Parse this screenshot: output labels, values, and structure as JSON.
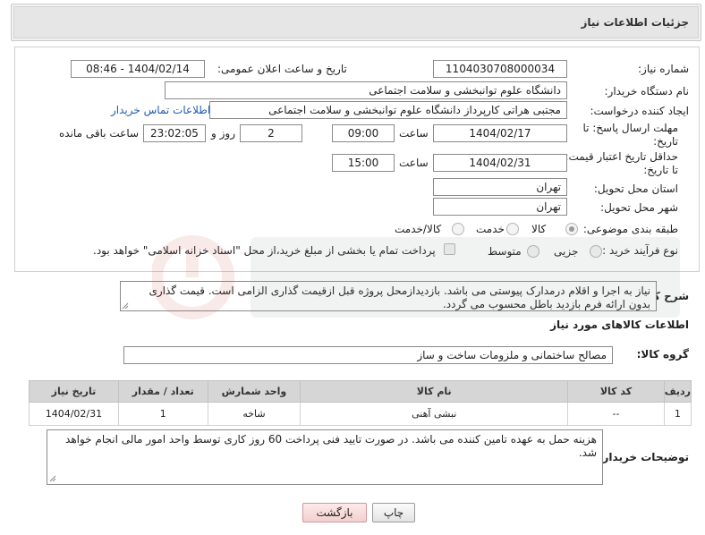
{
  "panel": {
    "title": "جزئیات اطلاعات نیاز"
  },
  "form": {
    "need_number": {
      "label": "شماره نیاز:",
      "value": "1104030708000034"
    },
    "announce_datetime": {
      "label": "تاریخ و ساعت اعلان عمومی:",
      "value": "1404/02/14 - 08:46"
    },
    "buyer_org": {
      "label": "نام دستگاه خریدار:",
      "value": "دانشگاه علوم توانبخشی و سلامت اجتماعی"
    },
    "requester": {
      "label": "ایجاد کننده درخواست:",
      "value": "مجتبی هراتی کارپرداز دانشگاه علوم توانبخشی و سلامت اجتماعی",
      "contact_link": "اطلاعات تماس خریدار"
    },
    "reply_deadline": {
      "label_line1": "مهلت ارسال پاسخ: تا",
      "label_line2": "تاریخ:",
      "date": "1404/02/17",
      "time_label": "ساعت",
      "time": "09:00",
      "days": "2",
      "days_label": "روز و",
      "remaining": "23:02:05",
      "remaining_label": "ساعت باقی مانده"
    },
    "price_validity": {
      "label_line1": "حداقل تاریخ اعتبار قیمت:",
      "label_line2": "تا تاریخ:",
      "date": "1404/02/31",
      "time_label": "ساعت",
      "time": "15:00"
    },
    "delivery_province": {
      "label": "استان محل تحویل:",
      "value": "تهران"
    },
    "delivery_city": {
      "label": "شهر محل تحویل:",
      "value": "تهران"
    },
    "category": {
      "label": "طبقه بندی موضوعی:",
      "options": [
        "کالا",
        "خدمت",
        "کالا/خدمت"
      ],
      "selected": "کالا"
    },
    "purchase_type": {
      "label": "نوع فرآیند خرید :",
      "options": [
        "جزیی",
        "متوسط"
      ],
      "selected": "",
      "payment_note": "پرداخت تمام یا بخشی از مبلغ خرید،از محل \"اسناد خزانه اسلامی\" خواهد بود."
    }
  },
  "description": {
    "label": "شرح کلی نیاز:",
    "text": "نیاز به اجرا و اقلام درمدارک پیوستی می باشد. بازدیدازمحل پروژه قبل ازقیمت گذاری الزامی است. قیمت گذاری بدون ارائه فرم بازدید باطل محسوب می گردد."
  },
  "goods_section": {
    "title": "اطلاعات کالاهای مورد نیاز",
    "group_label": "گروه کالا:",
    "group_value": "مصالح ساختمانی و ملزومات ساخت و ساز"
  },
  "table": {
    "headers": [
      "ردیف",
      "کد کالا",
      "نام کالا",
      "واحد شمارش",
      "تعداد / مقدار",
      "تاریخ نیاز"
    ],
    "rows": [
      [
        "1",
        "--",
        "نبشی آهنی",
        "شاخه",
        "1",
        "1404/02/31"
      ]
    ]
  },
  "buyer_notes": {
    "label": "توضیحات خریدار:",
    "text": "هزینه حمل به عهده تامین کننده می باشد. در صورت تایید فنی پرداخت 60 روز کاری توسط واحد امور مالی انجام خواهد شد."
  },
  "buttons": {
    "print": "چاپ",
    "back": "بازگشت"
  },
  "colors": {
    "link": "#1f5fb4",
    "header_bg": "#e6e6e6",
    "table_header_bg": "#d6d6d6",
    "back_button": "#f3cfcf"
  }
}
